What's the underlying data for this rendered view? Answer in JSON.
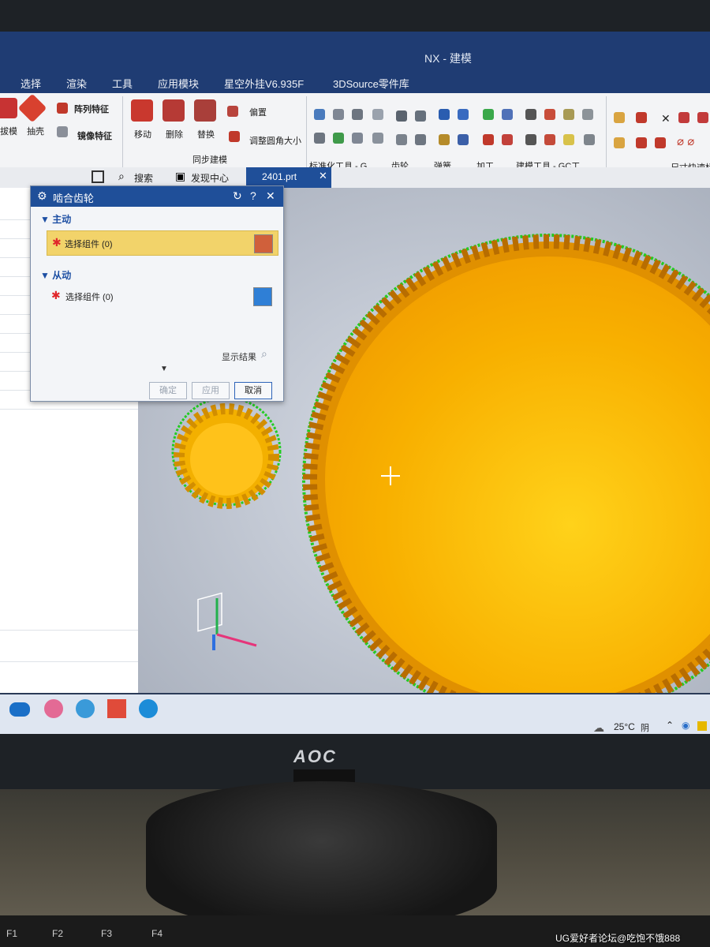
{
  "window": {
    "title": "NX - 建模"
  },
  "menubar": {
    "items": [
      "选择",
      "渲染",
      "工具",
      "应用模块",
      "星空外挂V6.935F",
      "3DSource零件库"
    ]
  },
  "ribbon": {
    "features": {
      "big1": "拔模",
      "big2": "抽壳",
      "array": "阵列特征",
      "mirror": "镜像特征"
    },
    "sync": {
      "move": "移动",
      "delete": "删除",
      "replace": "替换",
      "offset": "偏置",
      "resize_blend": "调整圆角大小",
      "group": "同步建模"
    },
    "groups": [
      "标准化工具 - G...",
      "齿轮...",
      "弹簧...",
      "加工...",
      "建模工具 - GC工...",
      "尺寸快速标"
    ]
  },
  "tabs": {
    "search": "搜索",
    "discover": "发现中心",
    "file": "2401.prt"
  },
  "dialog": {
    "title": "啮合齿轮",
    "primary_section": "主动",
    "primary_select": "选择组件 (0)",
    "secondary_section": "从动",
    "secondary_select": "选择组件 (0)",
    "show_result": "显示结果",
    "ok": "确定",
    "apply": "应用",
    "cancel": "取消"
  },
  "taskbar": {
    "weather": "25°C",
    "weather_desc": "阴"
  },
  "monitor": {
    "brand": "AOC"
  },
  "keyboard": {
    "keys": [
      "F1",
      "F2",
      "F3",
      "F4"
    ]
  },
  "watermark": "UG爱好者论坛@吃饱不饿888",
  "colors": {
    "gear": "#f5a300",
    "highlight": "#22cc22",
    "dialog_header": "#1f4f99",
    "selection_bar": "#f2d36a"
  }
}
